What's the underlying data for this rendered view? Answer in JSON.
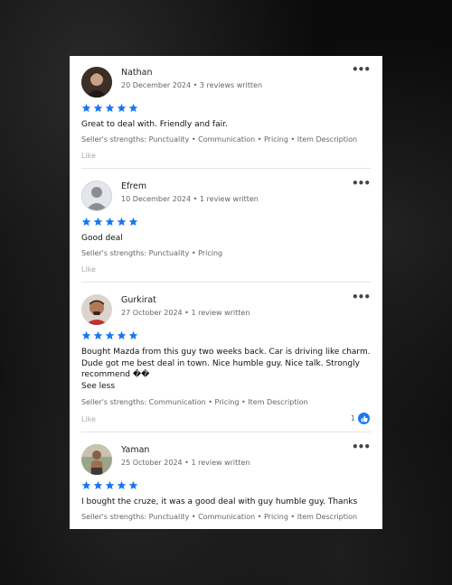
{
  "reviews": [
    {
      "name": "Nathan",
      "meta": "20 December 2024 • 3 reviews written",
      "rating": 5,
      "text": "Great to deal with. Friendly and fair.",
      "strengths": "Seller's strengths: Punctuality • Communication • Pricing • Item Description",
      "like_label": "Like",
      "avatar": "photo-avatar"
    },
    {
      "name": "Efrem",
      "meta": "10 December 2024 • 1 review written",
      "rating": 5,
      "text": "Good deal",
      "strengths": "Seller's strengths: Punctuality • Pricing",
      "like_label": "Like",
      "avatar": "default-avatar"
    },
    {
      "name": "Gurkirat",
      "meta": "27 October 2024 • 1 review written",
      "rating": 5,
      "text": "Bought Mazda from this guy two weeks back. Car is driving like charm. Dude got me best deal in town. Nice humble guy. Nice talk. Strongly recommend ��",
      "see_less": "See less",
      "strengths": "Seller's strengths: Communication • Pricing • Item Description",
      "like_label": "Like",
      "like_count": "1",
      "avatar": "photo-avatar"
    },
    {
      "name": "Yaman",
      "meta": "25 October 2024 • 1 review written",
      "rating": 5,
      "text": "I bought the cruze, it was a good deal with guy humble guy. Thanks",
      "strengths": "Seller's strengths: Punctuality • Communication • Pricing • Item Description",
      "avatar": "photo-avatar"
    }
  ],
  "menu_icon": "more-dots-icon",
  "star_color": "#1877f2",
  "accent": "#1877f2"
}
